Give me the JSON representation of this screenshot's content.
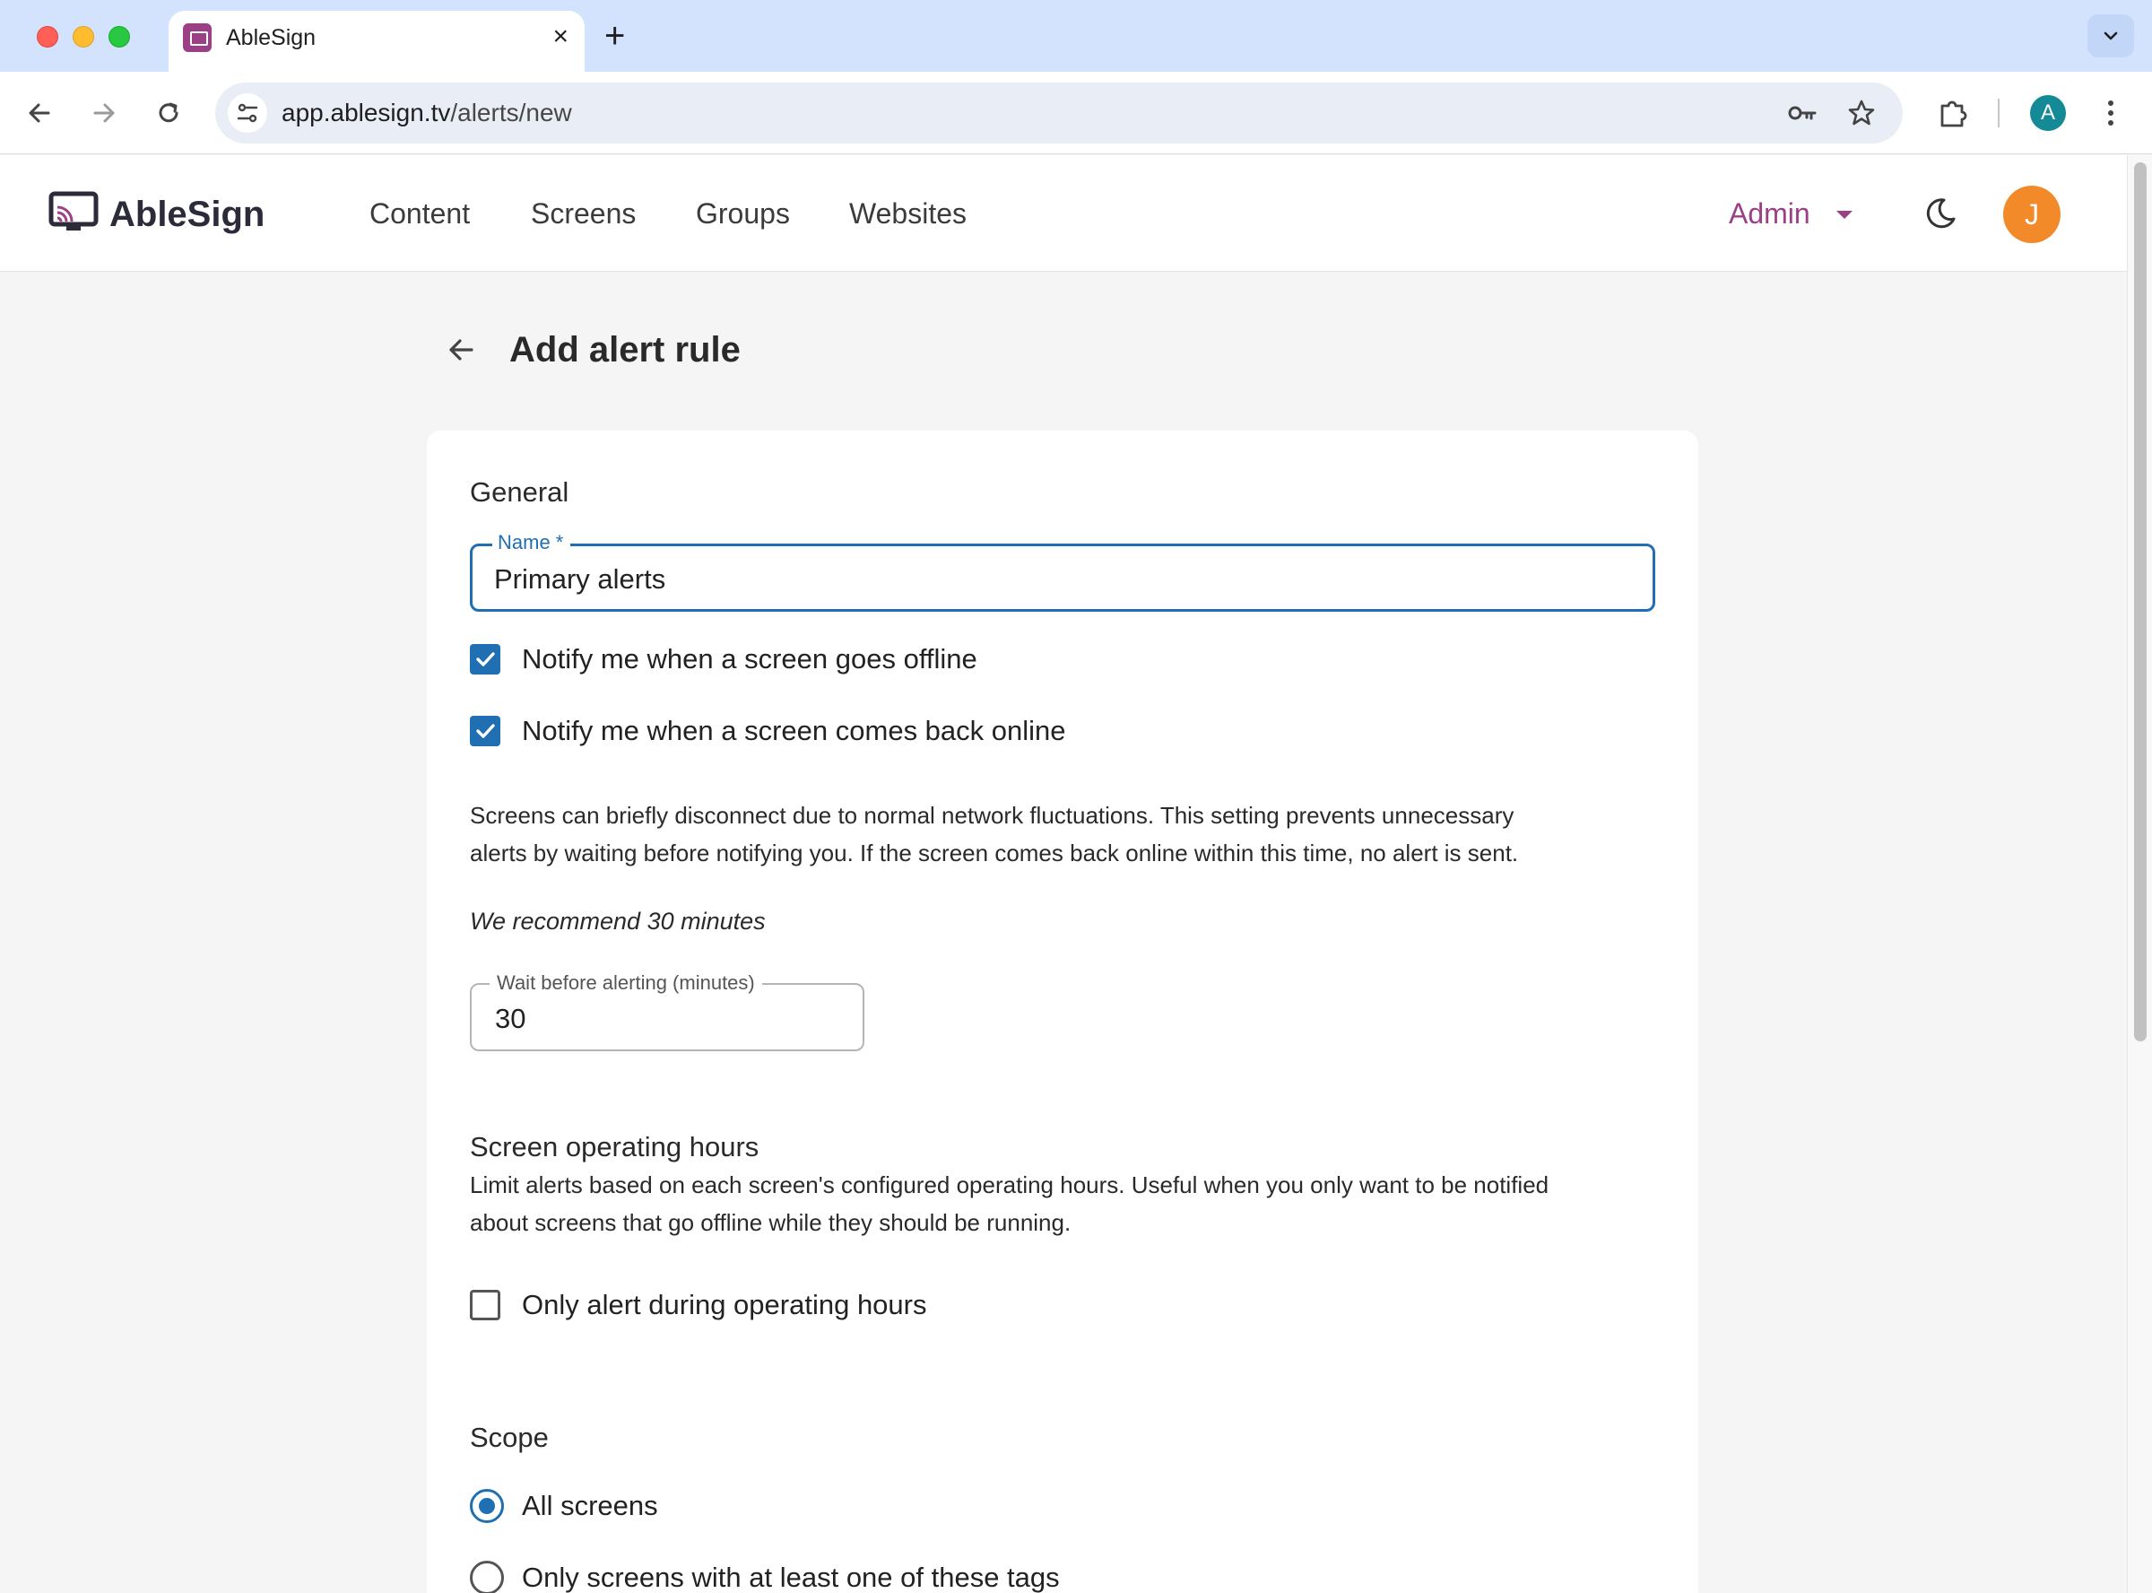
{
  "browser": {
    "tab_title": "AbleSign",
    "tab_close": "×",
    "new_tab": "+",
    "url_host": "app.ablesign.tv",
    "url_path": "/alerts/new",
    "profile_initial": "A"
  },
  "app": {
    "brand": "AbleSign",
    "nav": [
      "Content",
      "Screens",
      "Groups",
      "Websites"
    ],
    "role_menu": "Admin",
    "user_initial": "J"
  },
  "page": {
    "title": "Add alert rule"
  },
  "form": {
    "general": {
      "heading": "General",
      "name_label": "Name *",
      "name_value": "Primary alerts"
    },
    "notify_offline": {
      "label": "Notify me when a screen goes offline",
      "checked": true
    },
    "notify_online": {
      "label": "Notify me when a screen comes back online",
      "checked": true
    },
    "delay_help_line1": "Screens can briefly disconnect due to normal network fluctuations. This setting prevents unnecessary",
    "delay_help_line2": "alerts by waiting before notifying you. If the screen comes back online within this time, no alert is sent.",
    "recommendation": "We recommend 30 minutes",
    "wait": {
      "label": "Wait before alerting (minutes)",
      "value": "30"
    },
    "operating_hours": {
      "heading": "Screen operating hours",
      "help_line1": "Limit alerts based on each screen's configured operating hours. Useful when you only want to be notified",
      "help_line2": "about screens that go offline while they should be running.",
      "checkbox_label": "Only alert during operating hours",
      "checked": false
    },
    "scope": {
      "heading": "Scope",
      "options": [
        {
          "label": "All screens",
          "selected": true
        },
        {
          "label": "Only screens with at least one of these tags",
          "selected": false
        }
      ]
    }
  },
  "colors": {
    "accent": "#1f6fb2",
    "brand": "#9b3f86",
    "avatar": "#f38a2a"
  }
}
